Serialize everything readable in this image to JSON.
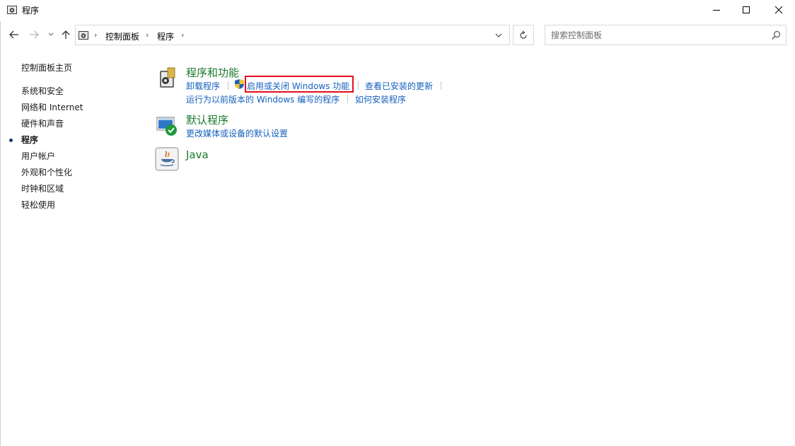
{
  "window": {
    "title": "程序"
  },
  "address": {
    "crumbs": [
      "控制面板",
      "程序"
    ]
  },
  "search": {
    "placeholder": "搜索控制面板"
  },
  "sidebar": {
    "home": "控制面板主页",
    "items": [
      {
        "label": "系统和安全",
        "current": false
      },
      {
        "label": "网络和 Internet",
        "current": false
      },
      {
        "label": "硬件和声音",
        "current": false
      },
      {
        "label": "程序",
        "current": true
      },
      {
        "label": "用户帐户",
        "current": false
      },
      {
        "label": "外观和个性化",
        "current": false
      },
      {
        "label": "时钟和区域",
        "current": false
      },
      {
        "label": "轻松使用",
        "current": false
      }
    ]
  },
  "categories": {
    "programs": {
      "title": "程序和功能",
      "links": {
        "uninstall": "卸载程序",
        "features": "启用或关闭 Windows 功能",
        "updates": "查看已安装的更新",
        "compat": "运行为以前版本的 Windows 编写的程序",
        "howto": "如何安装程序"
      }
    },
    "defaults": {
      "title": "默认程序",
      "links": {
        "media": "更改媒体或设备的默认设置"
      }
    },
    "java": {
      "title": "Java"
    }
  },
  "colors": {
    "category_title": "#1a7a2e",
    "link": "#1560bd",
    "highlight": "#e0101c"
  }
}
